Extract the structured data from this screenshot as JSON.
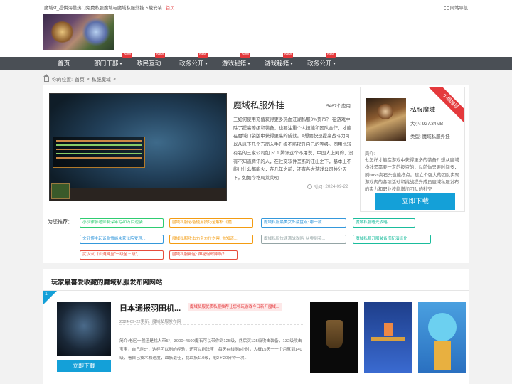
{
  "topbar": {
    "left_text": "魔域sf_提供海量热门免费私服魔域与魔域私服外挂下载安装",
    "left_link": "首页",
    "right_text": "网站导航"
  },
  "nav": {
    "items": [
      {
        "label": "首页",
        "new": false,
        "dropdown": false
      },
      {
        "label": "部门干部",
        "new": true,
        "dropdown": true
      },
      {
        "label": "政民互动",
        "new": true,
        "dropdown": false
      },
      {
        "label": "政务公开",
        "new": true,
        "dropdown": true
      },
      {
        "label": "游戏秘籍",
        "new": true,
        "dropdown": true
      },
      {
        "label": "游戏秘籍",
        "new": true,
        "dropdown": true
      },
      {
        "label": "政务公开",
        "new": true,
        "dropdown": true
      }
    ],
    "new_label": "New"
  },
  "breadcrumb": {
    "prefix": "你的位置:",
    "home": "首页",
    "current": "私服魔域",
    "sep": ">"
  },
  "app": {
    "title": "魔域私服外挂",
    "count": "5467个应用",
    "description": "三如何使用充值获得更多热血江湖私服0%货币？ 在游戏中除了提高等级和装备，也要注重个人技能和团队合作，才能在魔域口袋版中获得更高的成就。A想要快速提高战斗力可以从以下几个方面入手升级不断提升自己的等级。固用比较有名的三家公司如下: 1.腾讯这个不用说，中国人上网的，没有不知道腾讯的人，在社交软件垄断的江山之下，基本上不能出什么都能火，在几年之前，还有各大游戏公司共分天下，如如今格局莱莱明",
    "time_label": "时间:",
    "time": "2024-09-22"
  },
  "side": {
    "ribbon": "小编推荐",
    "name": "私服魔域",
    "size_label": "大小:",
    "size": "927.34MB",
    "type_label": "类型:",
    "type": "魔域私服外挂",
    "intro_label": "简介:",
    "intro": "七怎样才能在游戏中获得更多的装备？想从魔域挣钱是需要一定的投资的，以前你只要时间多，刷boss卖石头也能挣点。建立个强大的团队实现游戏内的各项活动和挑战提升成员魔域私服发布的实力和职业技能增加团队的社交",
    "download": "立即下载"
  },
  "recommend": {
    "label": "为您推荐：",
    "tags": [
      {
        "text": "小伙律脉老师制深年亏40万后逆袭...",
        "color": "#2ecc71"
      },
      {
        "text": "魔域私服必备使用技巧全解析《魔...",
        "color": "#f39c12"
      },
      {
        "text": "魔域私服最美女外套盘点: 哪一款...",
        "color": "#3498db"
      },
      {
        "text": "魔域私服曜光攻略",
        "color": "#1abc9c"
      },
      {
        "text": "文轩博主起诉张雪峰未获法院受理...",
        "color": "#3498db"
      },
      {
        "text": "魔域私服攻击力全方位伤害: 你知道...",
        "color": "#f39c12"
      },
      {
        "text": "魔域私服快速满战攻略: 从零到英...",
        "color": "#95a5a6"
      },
      {
        "text": "魔域私服开服装备搭配演绎化",
        "color": "#1abc9c"
      },
      {
        "text": "武汉汉口江滩降至“一级至三级”,...",
        "color": "#e74c3c"
      },
      {
        "text": "魔域私服新区: 神秘何时降临?",
        "color": "#e74c3c"
      }
    ]
  },
  "section": {
    "heading": "玩家最喜爱收藏的魔域私服发布网网站",
    "rank": "1",
    "game": {
      "title": "日本通报羽田机...",
      "tag": "魔域私服优质私服推荐让您畅玩游戏今日新开魔域...",
      "date": "2024-09-22更新:",
      "category": "魔域私服发布网",
      "desc": "简介:老区一般还是找人带5*，3000~4500魔石可以带你到125级，然后买125级攻击装备，132级攻击宝宝，自己刷5*，这样可以刷的经验，还可以刷法宝，每天在线刷8小时，大概15天一一个月就到140级，看自己技术和速度，血族最佳，我血族110级，刷2＊20分钟一次...",
      "download": "立即下载"
    }
  },
  "colors": {
    "accent": "#14a0d8",
    "nav_bg": "#4a4f55",
    "new_badge": "#e4393c"
  }
}
